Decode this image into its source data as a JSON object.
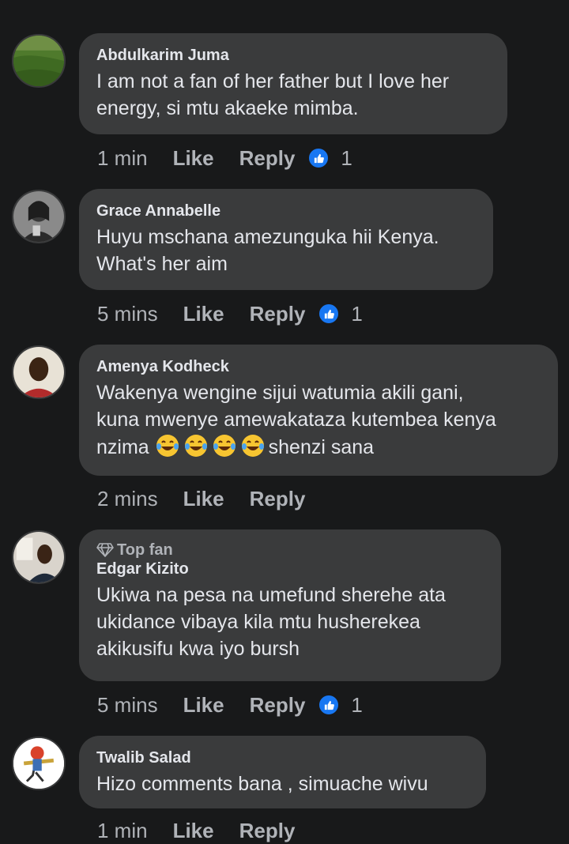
{
  "comments": [
    {
      "name": "Abdulkarim Juma",
      "lines": [
        "I am not a fan of her father but I love her",
        "energy, si mtu akaeke mimba."
      ],
      "time": "1 min",
      "like": "Like",
      "reply": "Reply",
      "reactions": "1"
    },
    {
      "name": "Grace Annabelle",
      "lines": [
        "Huyu mschana amezunguka hii Kenya.",
        "What's her aim"
      ],
      "time": "5 mins",
      "like": "Like",
      "reply": "Reply",
      "reactions": "1"
    },
    {
      "name": "Amenya Kodheck",
      "lines": [
        "Wakenya wengine sijui watumia akili gani,",
        "kuna mwenye amewakataza kutembea kenya"
      ],
      "line3_prefix": "nzima ",
      "line3_suffix": "shenzi sana",
      "emoji": "face-with-tears-of-joy",
      "time": "2 mins",
      "like": "Like",
      "reply": "Reply"
    },
    {
      "badge": "Top fan",
      "name": "Edgar Kizito",
      "lines": [
        "Ukiwa na pesa na umefund sherehe ata",
        "ukidance vibaya kila mtu husherekea",
        "akikusifu kwa iyo bursh"
      ],
      "time": "5 mins",
      "like": "Like",
      "reply": "Reply",
      "reactions": "1"
    },
    {
      "name": "Twalib Salad",
      "lines": [
        "Hizo comments bana , simuache wivu"
      ],
      "time": "1 min",
      "like": "Like",
      "reply": "Reply"
    }
  ],
  "colors": {
    "background": "#18191a",
    "bubble": "#3a3b3c",
    "text": "#e4e6eb",
    "secondary": "#b0b3b8",
    "like_reaction": "#1877f2"
  }
}
